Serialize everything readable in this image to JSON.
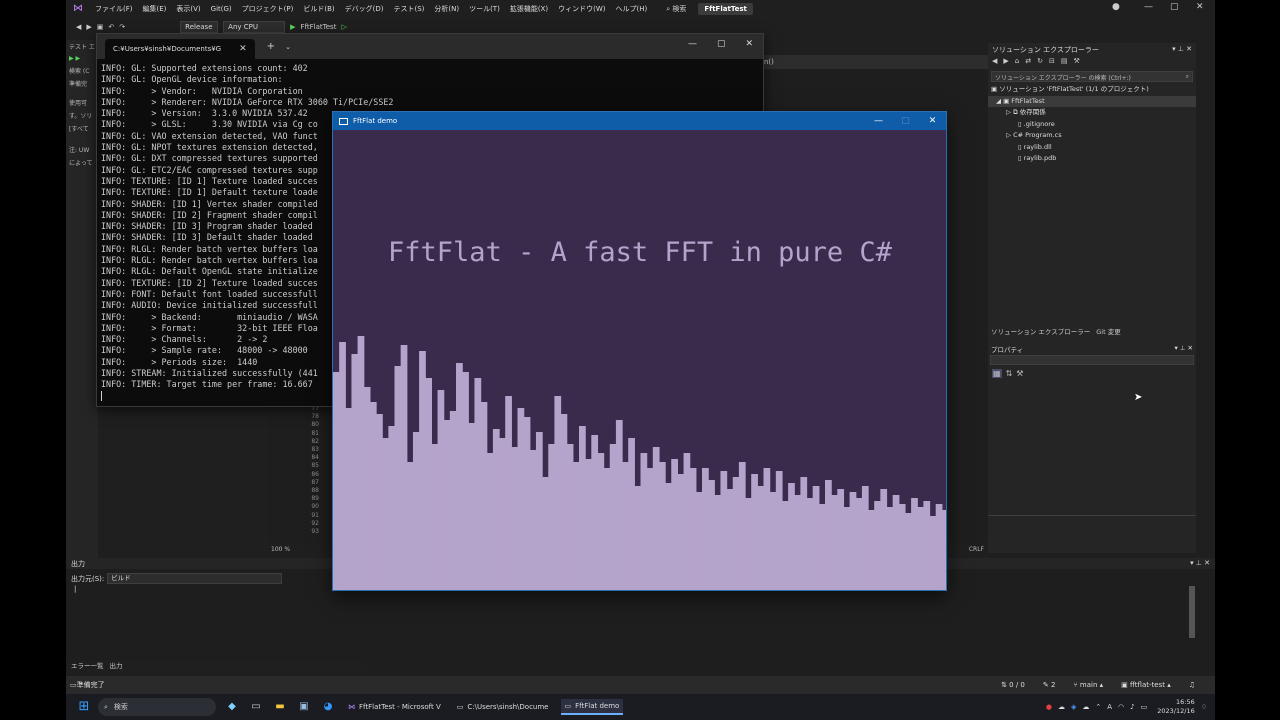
{
  "vs": {
    "menu": [
      "ファイル(F)",
      "編集(E)",
      "表示(V)",
      "Git(G)",
      "プロジェクト(P)",
      "ビルド(B)",
      "デバッグ(D)",
      "テスト(S)",
      "分析(N)",
      "ツール(T)",
      "拡張機能(X)",
      "ウィンドウ(W)",
      "ヘルプ(H)"
    ],
    "search_label": "検索",
    "solution_name": "FftFlatTest",
    "config": "Release",
    "platform": "Any CPU",
    "run_target": "FftFlatTest",
    "left_pane": [
      "テスト エ",
      "検索 (C",
      "準備完",
      "使用可",
      "す。ソリ",
      "[すべて",
      "注: UW",
      "によって"
    ],
    "editor_tab": "n()",
    "line_numbers": [
      "77",
      "78",
      "80",
      "81",
      "82",
      "83",
      "84",
      "85",
      "86",
      "87",
      "88",
      "89",
      "90",
      "91",
      "92",
      "93"
    ],
    "zoom": "100 %",
    "crlf": "CRLF"
  },
  "solution_explorer": {
    "title": "ソリューション エクスプローラー",
    "search_placeholder": "ソリューション エクスプローラー の検索 (Ctrl+:)",
    "items": [
      "ソリューション 'FftFlatTest' (1/1 のプロジェクト)",
      "FftFlatTest",
      "依存関係",
      ".gitignore",
      "Program.cs",
      "raylib.dll",
      "raylib.pdb"
    ],
    "tab_solution": "ソリューション エクスプローラー",
    "tab_git": "Git 変更",
    "properties_title": "プロパティ"
  },
  "output": {
    "title": "出力",
    "source_label": "出力元(S):",
    "source_value": "ビルド",
    "bottom_tabs": [
      "エラー一覧",
      "出力"
    ]
  },
  "vs_status": {
    "ready": "準備完了",
    "lines": "0 / 0",
    "edits": "2",
    "branch": "main",
    "repo": "fftflat-test"
  },
  "taskbar": {
    "search": "検索",
    "apps": [
      "FftFlatTest - Microsoft V",
      "C:\\Users\\sinsh\\Docume",
      "FftFlat demo"
    ],
    "time": "16:56",
    "date": "2023/12/16"
  },
  "console": {
    "tab_title": "C:¥Users¥sinsh¥Documents¥G",
    "lines": [
      "INFO: GL: Supported extensions count: 402",
      "INFO: GL: OpenGL device information:",
      "INFO:     > Vendor:   NVIDIA Corporation",
      "INFO:     > Renderer: NVIDIA GeForce RTX 3060 Ti/PCIe/SSE2",
      "INFO:     > Version:  3.3.0 NVIDIA 537.42",
      "INFO:     > GLSL:     3.30 NVIDIA via Cg co",
      "INFO: GL: VAO extension detected, VAO funct",
      "INFO: GL: NPOT textures extension detected,",
      "INFO: GL: DXT compressed textures supported",
      "INFO: GL: ETC2/EAC compressed textures supp",
      "INFO: TEXTURE: [ID 1] Texture loaded succes",
      "INFO: TEXTURE: [ID 1] Default texture loade",
      "INFO: SHADER: [ID 1] Vertex shader compiled",
      "INFO: SHADER: [ID 2] Fragment shader compil",
      "INFO: SHADER: [ID 3] Program shader loaded",
      "INFO: SHADER: [ID 3] Default shader loaded",
      "INFO: RLGL: Render batch vertex buffers loa",
      "INFO: RLGL: Render batch vertex buffers loa",
      "INFO: RLGL: Default OpenGL state initialize",
      "INFO: TEXTURE: [ID 2] Texture loaded succes",
      "INFO: FONT: Default font loaded successfull",
      "INFO: AUDIO: Device initialized successfull",
      "INFO:     > Backend:       miniaudio / WASA",
      "INFO:     > Format:        32-bit IEEE Floa",
      "INFO:     > Channels:      2 -> 2",
      "INFO:     > Sample rate:   48000 -> 48000",
      "INFO:     > Periods size:  1440",
      "INFO: STREAM: Initialized successfully (441",
      "INFO: TIMER: Target time per frame: 16.667"
    ]
  },
  "demo": {
    "window_title": "FftFlat demo",
    "heading": "FftFlat - A fast FFT in pure C#",
    "colors": {
      "background": "#3a2b4d",
      "spectrum": "#b4a3cb",
      "heading": "#b4a3cb"
    },
    "spectrum": [
      0.6,
      0.7,
      0.48,
      0.66,
      0.72,
      0.55,
      0.5,
      0.46,
      0.38,
      0.42,
      0.62,
      0.69,
      0.3,
      0.4,
      0.67,
      0.58,
      0.36,
      0.54,
      0.44,
      0.47,
      0.63,
      0.6,
      0.43,
      0.58,
      0.5,
      0.33,
      0.41,
      0.38,
      0.52,
      0.35,
      0.48,
      0.45,
      0.34,
      0.4,
      0.25,
      0.36,
      0.52,
      0.46,
      0.36,
      0.3,
      0.42,
      0.31,
      0.39,
      0.33,
      0.28,
      0.36,
      0.44,
      0.3,
      0.38,
      0.22,
      0.33,
      0.28,
      0.35,
      0.3,
      0.23,
      0.31,
      0.26,
      0.33,
      0.28,
      0.2,
      0.28,
      0.24,
      0.19,
      0.27,
      0.21,
      0.25,
      0.3,
      0.18,
      0.26,
      0.22,
      0.28,
      0.2,
      0.27,
      0.17,
      0.23,
      0.19,
      0.25,
      0.18,
      0.22,
      0.16,
      0.24,
      0.19,
      0.21,
      0.15,
      0.2,
      0.18,
      0.22,
      0.14,
      0.17,
      0.21,
      0.15,
      0.19,
      0.16,
      0.13,
      0.18,
      0.15,
      0.17,
      0.12,
      0.16,
      0.14
    ]
  }
}
